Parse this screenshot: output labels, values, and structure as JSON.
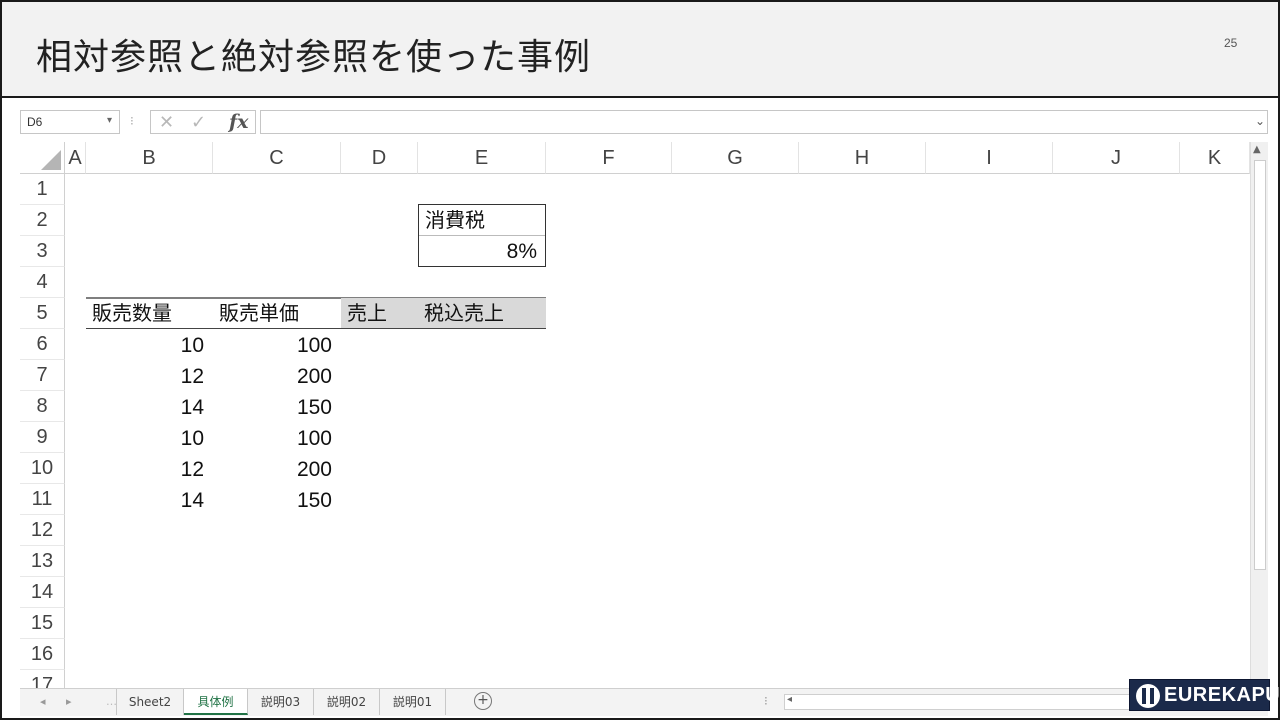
{
  "slide": {
    "title": "相対参照と絶対参照を使った事例",
    "page_number": "25"
  },
  "formula_bar": {
    "name_box": "D6",
    "formula": "",
    "cancel_icon": "x-icon",
    "enter_icon": "check-icon",
    "fx_label": "fx"
  },
  "grid": {
    "columns": [
      "A",
      "B",
      "C",
      "D",
      "E",
      "F",
      "G",
      "H",
      "I",
      "J",
      "K"
    ],
    "rows": [
      "1",
      "2",
      "3",
      "4",
      "5",
      "6",
      "7",
      "8",
      "9",
      "10",
      "11",
      "12",
      "13",
      "14",
      "15",
      "16",
      "17"
    ],
    "tax": {
      "label": "消費税",
      "value": "8%"
    },
    "table_headers": [
      "販売数量",
      "販売単価",
      "売上",
      "税込売上"
    ],
    "table_rows": [
      {
        "qty": "10",
        "price": "100"
      },
      {
        "qty": "12",
        "price": "200"
      },
      {
        "qty": "14",
        "price": "150"
      },
      {
        "qty": "10",
        "price": "100"
      },
      {
        "qty": "12",
        "price": "200"
      },
      {
        "qty": "14",
        "price": "150"
      }
    ]
  },
  "sheet_tabs": [
    "Sheet2",
    "具体例",
    "説明03",
    "説明02",
    "説明01"
  ],
  "active_tab": "具体例",
  "logo": {
    "text": "EUREKAPU"
  }
}
